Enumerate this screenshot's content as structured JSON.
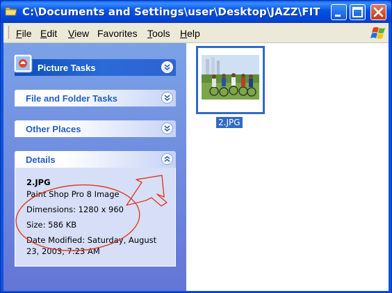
{
  "window": {
    "title": "C:\\Documents and Settings\\user\\Desktop\\JAZZ\\FIT"
  },
  "menubar": {
    "items": [
      {
        "label": "File",
        "key": "F",
        "rest": "ile"
      },
      {
        "label": "Edit",
        "key": "E",
        "rest": "dit"
      },
      {
        "label": "View",
        "key": "V",
        "rest": "iew"
      },
      {
        "label": "Favorites",
        "key": "",
        "rest": "Favorites"
      },
      {
        "label": "Tools",
        "key": "T",
        "rest": "ools"
      },
      {
        "label": "Help",
        "key": "H",
        "rest": "elp"
      }
    ]
  },
  "taskpane": {
    "picture_tasks": "Picture Tasks",
    "file_folder_tasks": "File and Folder Tasks",
    "other_places": "Other Places",
    "details": {
      "title": "Details",
      "filename": "2.JPG",
      "type": "Paint Shop Pro 8 Image",
      "dimensions": "Dimensions: 1280 x 960",
      "size": "Size: 586 KB",
      "date_line1": "Date Modified: Saturday, August",
      "date_line2": "23, 2003, 7:23 AM"
    }
  },
  "files": [
    {
      "name": "2.JPG",
      "selected": true
    }
  ],
  "colors": {
    "titlebar": "#0052E6",
    "taskpane": "#7BA2E7",
    "selection": "#316AC5",
    "annotation": "#E23A1E"
  }
}
